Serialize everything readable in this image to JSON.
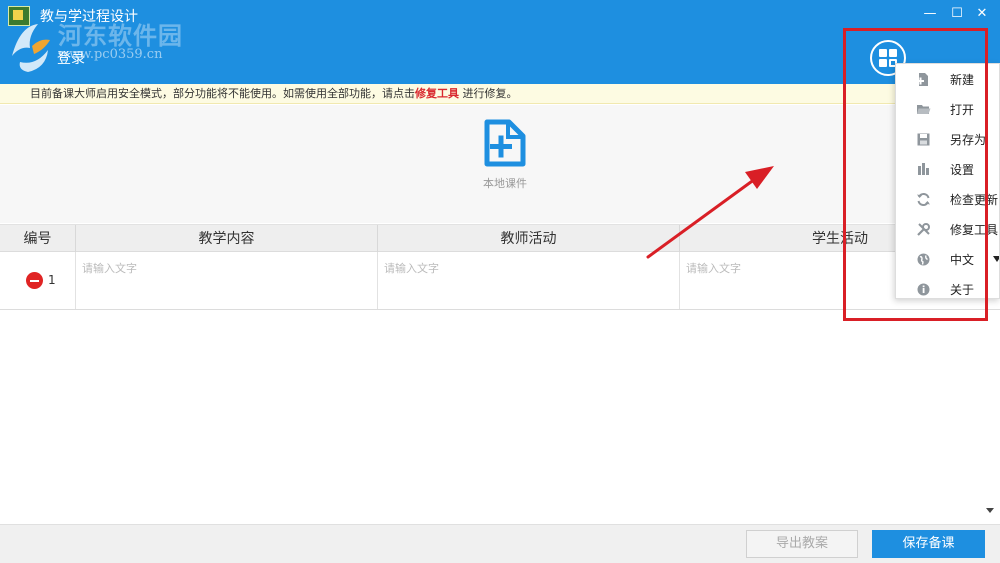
{
  "window": {
    "title": "教与学过程设计",
    "minimize_glyph": "—",
    "maximize_glyph": "☐",
    "close_glyph": "✕"
  },
  "watermark": {
    "text": "河东软件园",
    "url": "www.pc0359.cn"
  },
  "header": {
    "login_label": "登录",
    "menu_icon": "grid-icon"
  },
  "notice": {
    "text_before": "目前备课大师启用安全模式，部分功能将不能使用。如需使用全部功能，请点击",
    "link_text": "修复工具",
    "text_after": " 进行修复。"
  },
  "courseware": {
    "local_label": "本地课件",
    "icon": "add-file-icon"
  },
  "table": {
    "columns": [
      "编号",
      "教学内容",
      "教师活动",
      "学生活动"
    ],
    "rows": [
      {
        "number": "1",
        "content": "",
        "teacher": "",
        "student": ""
      }
    ],
    "cell_placeholder": "请输入文字"
  },
  "footer": {
    "export_label": "导出教案",
    "save_label": "保存备课"
  },
  "menu": {
    "items": [
      {
        "label": "新建",
        "icon": "new-file-icon"
      },
      {
        "label": "打开",
        "icon": "folder-open-icon"
      },
      {
        "label": "另存为",
        "icon": "save-as-icon"
      },
      {
        "label": "设置",
        "icon": "settings-icon"
      },
      {
        "label": "检查更新",
        "icon": "refresh-icon"
      },
      {
        "label": "修复工具",
        "icon": "repair-tools-icon"
      },
      {
        "label": "中文",
        "icon": "globe-icon"
      },
      {
        "label": "关于",
        "icon": "info-icon"
      }
    ]
  },
  "colors": {
    "brand_blue": "#1e8fe0",
    "notice_bg": "#fdfbe2",
    "link_red": "#d9292f",
    "annotation_red": "#d91f26",
    "menu_icon_gray": "#8f969c"
  }
}
